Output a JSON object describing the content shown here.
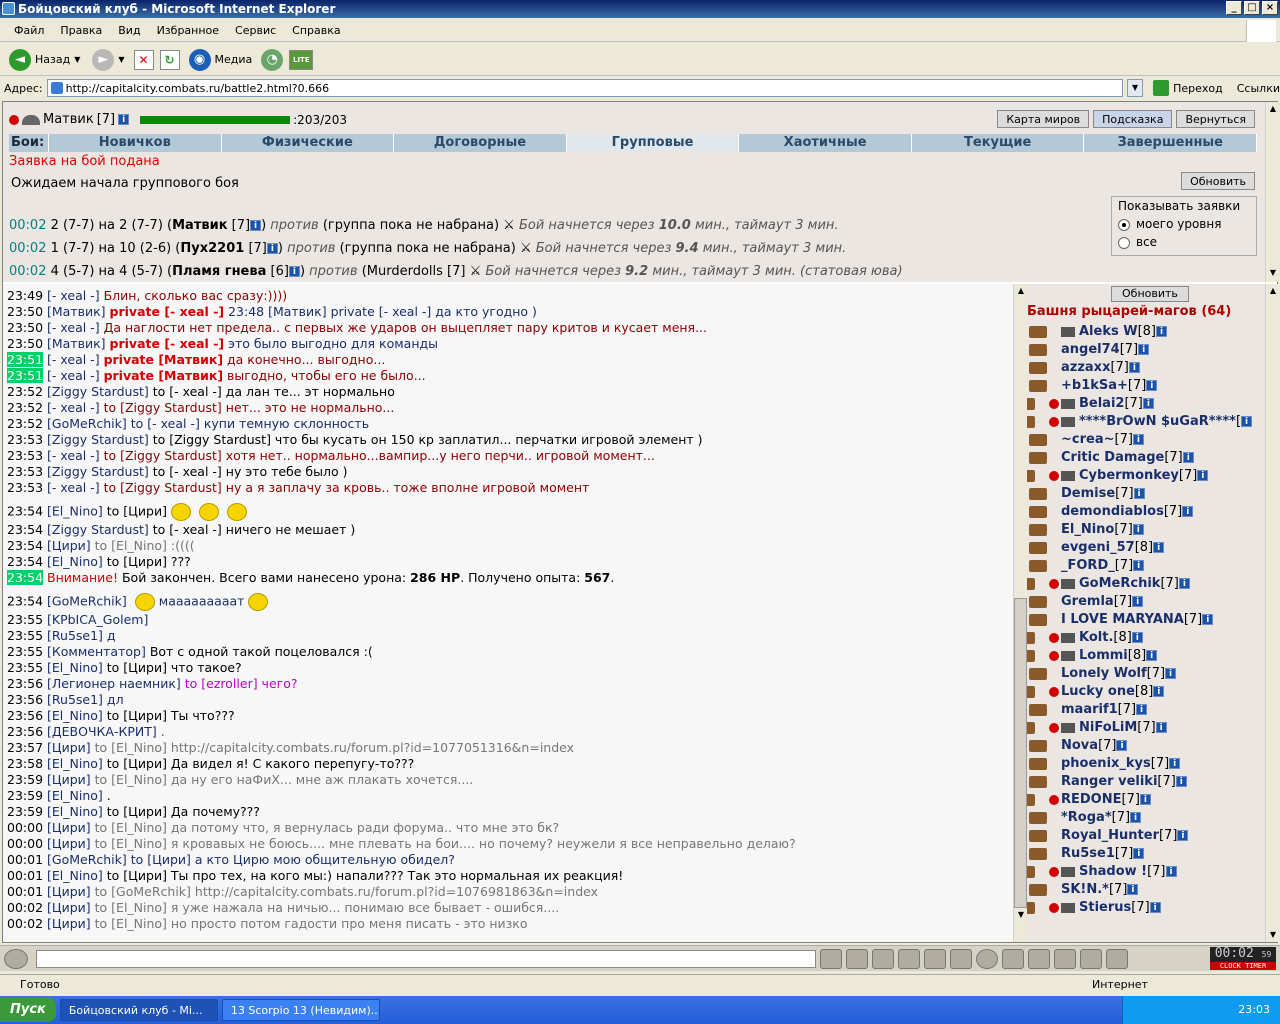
{
  "window": {
    "title": "Бойцовский клуб - Microsoft Internet Explorer"
  },
  "menu": [
    "Файл",
    "Правка",
    "Вид",
    "Избранное",
    "Сервис",
    "Справка"
  ],
  "toolbar": {
    "back": "Назад",
    "media": "Медиа"
  },
  "address": {
    "label": "Адрес:",
    "url": "http://capitalcity.combats.ru/battle2.html?0.666",
    "go": "Переход",
    "links": "Ссылки"
  },
  "player": {
    "name": "Матвик",
    "level": "[7]",
    "hp": "203/203",
    "hp_fraction": 1.0
  },
  "top_buttons": [
    "Карта миров",
    "Подсказка",
    "Вернуться"
  ],
  "tabs": {
    "label": "Бои:",
    "items": [
      "Новичков",
      "Физические",
      "Договорные",
      "Групповые",
      "Хаотичные",
      "Текущие",
      "Завершенные"
    ],
    "active": "Групповые"
  },
  "notice": "Заявка на бой подана",
  "wait": "Ожидаем начала группового боя",
  "refresh": "Обновить",
  "battles": [
    {
      "time": "00:02",
      "a": "2 (7-7) на 2 (7-7) (",
      "who": "Матвик",
      "lvl": "[7]",
      "vs": "против",
      "rest": "(группа пока не набрана)",
      "info": "Бой начнется через",
      "mins": "10.0",
      "tail": "мин., таймаут 3 мин."
    },
    {
      "time": "00:02",
      "a": "1 (7-7) на 10 (2-6) (",
      "who": "Пух2201",
      "lvl": "[7]",
      "vs": "против",
      "rest": "(группа пока не набрана)",
      "info": "Бой начнется через",
      "mins": "9.4",
      "tail": "мин., таймаут 3 мин."
    },
    {
      "time": "00:02",
      "a": "4 (5-7) на 4 (5-7) (",
      "who": "Пламя гнева",
      "lvl": "[6]",
      "vs": "против",
      "rest": "(Murderdolls [7]",
      "info": "Бой начнется через",
      "mins": "9.2",
      "tail": "мин., таймаут 3 мин. (статовая юва)"
    }
  ],
  "show": {
    "title": "Показывать заявки",
    "opt1": "моего уровня",
    "opt2": "все"
  },
  "chat": [
    {
      "t": "23:49",
      "n": "[- xeal -]",
      "m": "Блин, сколько вас сразу:))))",
      "c": "dk"
    },
    {
      "t": "23:50",
      "n": "[Матвик]",
      "p": "private [- xeal -]",
      "m": "23:48 [Матвик] private [- xeal -] да кто угодно )",
      "c": "bl2"
    },
    {
      "t": "23:50",
      "n": "[- xeal -]",
      "m": "Да наглости нет предела.. с первых же ударов он выцепляет пару критов и кусает меня...",
      "c": "dk"
    },
    {
      "t": "23:50",
      "n": "[Матвик]",
      "p": "private [- xeal -]",
      "m": "это было выгодно для команды",
      "c": "bl2"
    },
    {
      "t": "23:51",
      "h": true,
      "n": "[- xeal -]",
      "p": "private [Матвик]",
      "m": "да конечно... выгодно...",
      "c": "dk"
    },
    {
      "t": "23:51",
      "h": true,
      "n": "[- xeal -]",
      "p": "private [Матвик]",
      "m": "выгодно, чтобы его не было...",
      "c": "dk"
    },
    {
      "t": "23:52",
      "n": "[Ziggy Stardust]",
      "m": "to [- xeal -] да лан те... эт нормально",
      "c": ""
    },
    {
      "t": "23:52",
      "n": "[- xeal -]",
      "m": "to [Ziggy Stardust] нет... это не нормально...",
      "c": "dk"
    },
    {
      "t": "23:52",
      "n": "[GoMeRchik]",
      "m": "to [- xeal -] купи темную склонность",
      "c": "bl2"
    },
    {
      "t": "23:53",
      "n": "[Ziggy Stardust]",
      "m": "to [Ziggy Stardust] что бы кусать он 150 кр заплатил... перчатки игровой элемент )",
      "c": ""
    },
    {
      "t": "23:53",
      "n": "[- xeal -]",
      "m": "to [Ziggy Stardust] хотя нет.. нормально...вампир...у него перчи.. игровой момент...",
      "c": "dk"
    },
    {
      "t": "23:53",
      "n": "[Ziggy Stardust]",
      "m": "to [- xeal -] ну это тебе было )",
      "c": ""
    },
    {
      "t": "23:53",
      "n": "[- xeal -]",
      "m": "to [Ziggy Stardust] ну а я заплачу за кровь.. тоже вполне игровой момент",
      "c": "dk"
    },
    {
      "t": "23:54",
      "n": "[El_Nino]",
      "m": "to [Цири]",
      "c": "",
      "smiles": 3
    },
    {
      "t": "23:54",
      "n": "[Ziggy Stardust]",
      "m": "to [- xeal -] ничего не мешает )",
      "c": ""
    },
    {
      "t": "23:54",
      "n": "[Цири]",
      "m": "to [El_Nino] :((((",
      "c": "gr"
    },
    {
      "t": "23:54",
      "n": "[El_Nino]",
      "m": "to [Цири] ???",
      "c": ""
    },
    {
      "t": "23:54",
      "h": true,
      "sys": true,
      "n": "Внимание!",
      "m": "Бой закончен. Всего вами нанесено урона:",
      "dmg": "286 HP",
      "m2": ". Получено опыта:",
      "exp": "567",
      "m3": "."
    },
    {
      "t": "23:54",
      "n": "[GoMeRchik]",
      "m": "мааааааааат",
      "c": "bl2",
      "smiles": 1
    },
    {
      "t": "23:55",
      "n": "[KPbICA_Golem]",
      "m": "",
      "c": ""
    },
    {
      "t": "23:55",
      "n": "[Ru5se1]",
      "m": "д",
      "c": "bl2"
    },
    {
      "t": "23:55",
      "n": "[Комментатор]",
      "m": "Вот с одной такой поцеловался :(",
      "c": ""
    },
    {
      "t": "23:55",
      "n": "[El_Nino]",
      "m": "to [Цири] что такое?",
      "c": ""
    },
    {
      "t": "23:56",
      "n": "[Легионер наемник]",
      "m": "to [ezroller] чего?",
      "c": "mg"
    },
    {
      "t": "23:56",
      "n": "[Ru5se1]",
      "m": "дл",
      "c": "bl2"
    },
    {
      "t": "23:56",
      "n": "[El_Nino]",
      "m": "to [Цири] Ты что???",
      "c": ""
    },
    {
      "t": "23:56",
      "n": "[ДЕВОЧКА-КРИТ]",
      "m": ".",
      "c": "mg"
    },
    {
      "t": "23:57",
      "n": "[Цири]",
      "m": "to [El_Nino] http://capitalcity.combats.ru/forum.pl?id=1077051316&n=index",
      "c": "gr"
    },
    {
      "t": "23:58",
      "n": "[El_Nino]",
      "m": "to [Цири] Да видел я! С какого перепугу-то???",
      "c": ""
    },
    {
      "t": "23:59",
      "n": "[Цири]",
      "m": "to [El_Nino] да ну его наФиХ... мне аж плакать хочется....",
      "c": "gr"
    },
    {
      "t": "23:59",
      "n": "[El_Nino]",
      "m": ".",
      "c": ""
    },
    {
      "t": "23:59",
      "n": "[El_Nino]",
      "m": "to [Цири] Да почему???",
      "c": ""
    },
    {
      "t": "00:00",
      "n": "[Цири]",
      "m": "to [El_Nino] да потому что, я вернулась ради форума.. что мне это бк?",
      "c": "gr"
    },
    {
      "t": "00:00",
      "n": "[Цири]",
      "m": "to [El_Nino] я кровавых не боюсь.... мне плевать на бои.... но почему? неужели я все неправельно делаю?",
      "c": "gr"
    },
    {
      "t": "00:01",
      "n": "[GoMeRchik]",
      "m": "to [Цири] а кто Цирю мою общительную обидел?",
      "c": "bl2"
    },
    {
      "t": "00:01",
      "n": "[El_Nino]",
      "m": "to [Цири] Ты про тех, на кого мы:) напали??? Так это нормальная их реакция!",
      "c": ""
    },
    {
      "t": "00:01",
      "n": "[Цири]",
      "m": "to [GoMeRchik] http://capitalcity.combats.ru/forum.pl?id=1076981863&n=index",
      "c": "gr"
    },
    {
      "t": "00:02",
      "n": "[Цири]",
      "m": "to [El_Nino] я уже нажала на ничью... понимаю все бывает - ошибся....",
      "c": "gr"
    },
    {
      "t": "00:02",
      "n": "[Цири]",
      "m": "to [El_Nino] но просто потом гадости про меня писать - это низко",
      "c": "gr"
    }
  ],
  "online": {
    "refresh": "Обновить",
    "title": "Башня рыцарей-магов (64)",
    "users": [
      {
        "n": "Aleks W",
        "l": "[8]",
        "c": 0,
        "f": 1
      },
      {
        "n": "angel74",
        "l": "[7]",
        "c": 0,
        "f": 0
      },
      {
        "n": "azzaxx",
        "l": "[7]",
        "c": 0,
        "f": 0
      },
      {
        "n": "+b1kSa+",
        "l": "[7]",
        "c": 0,
        "f": 0
      },
      {
        "n": "Belai2",
        "l": "[7]",
        "c": 1,
        "f": 1
      },
      {
        "n": "****BrOwN $uGaR****",
        "l": "[",
        "c": 2,
        "f": 1
      },
      {
        "n": "~crea~",
        "l": "[7]",
        "c": 0,
        "f": 0
      },
      {
        "n": "Critic Damage",
        "l": "[7]",
        "c": 0,
        "f": 0
      },
      {
        "n": "Cybermonkey",
        "l": "[7]",
        "c": 2,
        "f": 1
      },
      {
        "n": "Demise",
        "l": "[7]",
        "c": 0,
        "f": 0
      },
      {
        "n": "demondiablos",
        "l": "[7]",
        "c": 0,
        "f": 0
      },
      {
        "n": "El_Nino",
        "l": "[7]",
        "c": 0,
        "f": 0
      },
      {
        "n": "evgeni_57",
        "l": "[8]",
        "c": 0,
        "f": 0
      },
      {
        "n": "_FORD_",
        "l": "[7]",
        "c": 0,
        "f": 0
      },
      {
        "n": "GoMeRchik",
        "l": "[7]",
        "c": 2,
        "f": 1
      },
      {
        "n": "Gremla",
        "l": "[7]",
        "c": 0,
        "f": 0
      },
      {
        "n": "I LOVE MARYANA",
        "l": "[7]",
        "c": 0,
        "f": 0
      },
      {
        "n": "Kolt.",
        "l": "[8]",
        "c": 2,
        "f": 1
      },
      {
        "n": "Lommi",
        "l": "[8]",
        "c": 2,
        "f": 1
      },
      {
        "n": "Lonely Wolf",
        "l": "[7]",
        "c": 0,
        "f": 0
      },
      {
        "n": "Lucky one",
        "l": "[8]",
        "c": 1,
        "f": 0
      },
      {
        "n": "maarif1",
        "l": "[7]",
        "c": 0,
        "f": 0
      },
      {
        "n": "NiFoLiM",
        "l": "[7]",
        "c": 2,
        "f": 1
      },
      {
        "n": "Nova",
        "l": "[7]",
        "c": 0,
        "f": 0
      },
      {
        "n": "phoenix_kys",
        "l": "[7]",
        "c": 0,
        "f": 0
      },
      {
        "n": "Ranger veliki",
        "l": "[7]",
        "c": 0,
        "f": 0
      },
      {
        "n": "REDONE",
        "l": "[7]",
        "c": 1,
        "f": 0
      },
      {
        "n": "*Roga*",
        "l": "[7]",
        "c": 0,
        "f": 0
      },
      {
        "n": "Royal_Hunter",
        "l": "[7]",
        "c": 0,
        "f": 0
      },
      {
        "n": "Ru5se1",
        "l": "[7]",
        "c": 0,
        "f": 0
      },
      {
        "n": "Shadow !",
        "l": "[7]",
        "c": 1,
        "f": 1
      },
      {
        "n": "SK!N.*",
        "l": "[7]",
        "c": 0,
        "f": 0
      },
      {
        "n": "Stierus",
        "l": "[7]",
        "c": 2,
        "f": 1
      }
    ]
  },
  "clock": {
    "time": "00:02",
    "sec": "59",
    "label": "CLOCK TIMER"
  },
  "status": {
    "text": "Готово",
    "zone": "Интернет"
  },
  "taskbar": {
    "start": "Пуск",
    "tasks": [
      "Бойцовский клуб - Mi...",
      "13 Scorpio 13 (Невидим)..."
    ],
    "time": "23:03"
  }
}
